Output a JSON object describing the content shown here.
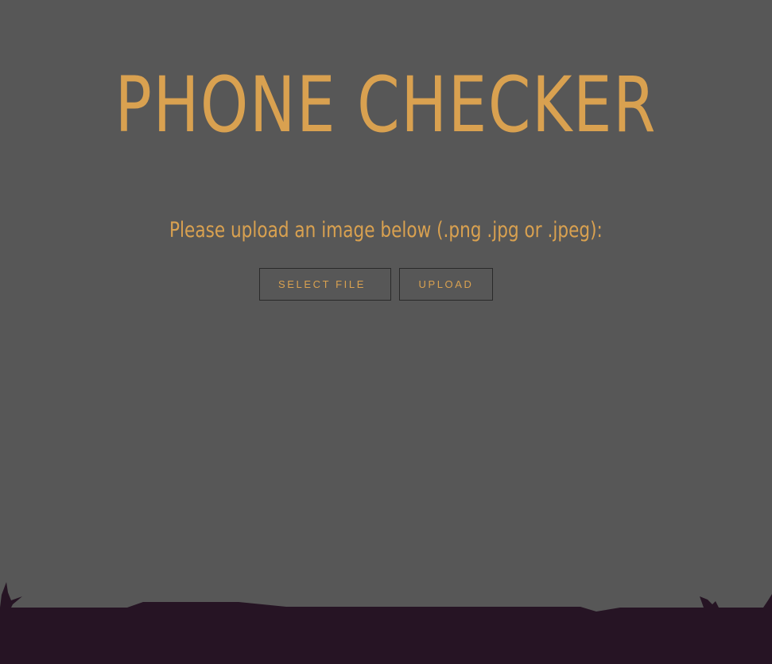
{
  "header": {
    "title": "PHONE CHECKER"
  },
  "upload": {
    "prompt": "Please upload an image below (.png .jpg or .jpeg):",
    "select_label": "SELECT FILE",
    "upload_label": "UPLOAD"
  },
  "colors": {
    "background": "#575757",
    "accent": "#d9a150",
    "ground": "#261424"
  }
}
